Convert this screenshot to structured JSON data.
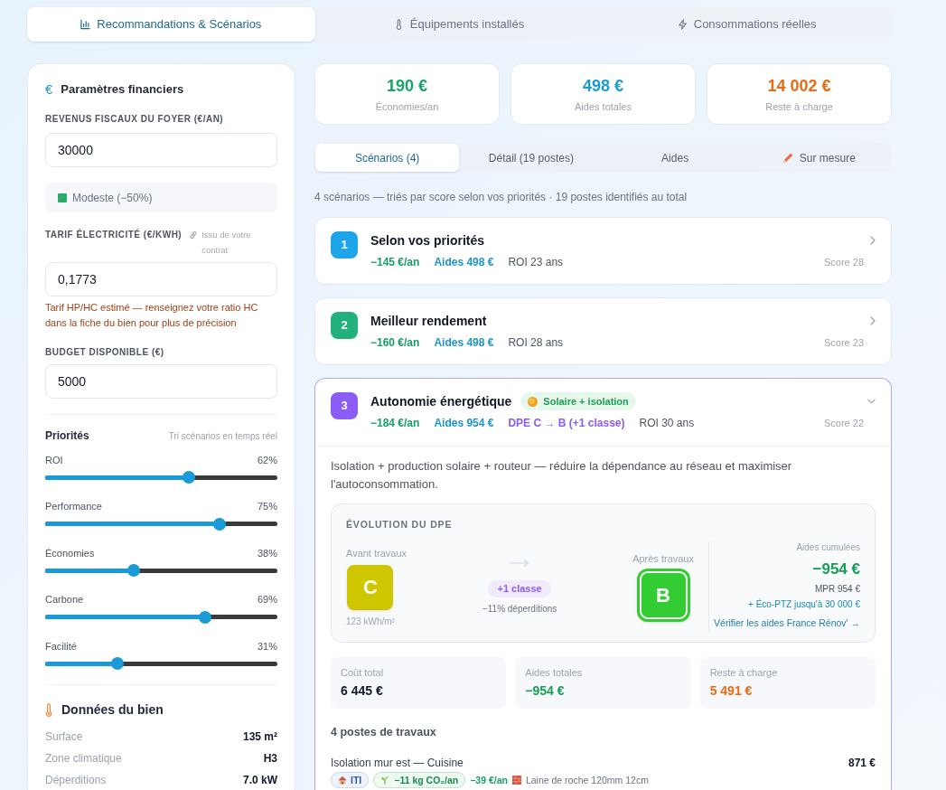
{
  "main_tabs": [
    {
      "label": "Recommandations & Scénarios",
      "selected": true
    },
    {
      "label": "Équipements installés",
      "selected": false
    },
    {
      "label": "Consommations réelles",
      "selected": false
    }
  ],
  "financial_parameters": {
    "icon": "€",
    "title": "Paramètres financiers",
    "income": {
      "label": "REVENUS FISCAUX DU FOYER (€/AN)",
      "value": "30000"
    },
    "income_category": "Modeste (−50%)",
    "tariff": {
      "label": "TARIF ÉLECTRICITÉ (€/KWH)",
      "source": "Issu de votre contrat",
      "value": "0,1773",
      "warning": "Tarif HP/HC estimé — renseignez votre ratio HC dans la fiche du bien pour plus de précision"
    },
    "budget": {
      "label": "BUDGET DISPONIBLE (€)",
      "value": "5000"
    }
  },
  "priorities": {
    "title": "Priorités",
    "hint": "Tri scénarios en temps réel",
    "sliders": [
      {
        "label": "ROI",
        "reading": "62%",
        "level": 0.62
      },
      {
        "label": "Performance",
        "reading": "75%",
        "level": 0.75
      },
      {
        "label": "Économies",
        "reading": "38%",
        "level": 0.38
      },
      {
        "label": "Carbone",
        "reading": "69%",
        "level": 0.69
      },
      {
        "label": "Facilité",
        "reading": "31%",
        "level": 0.31
      }
    ]
  },
  "property_data": {
    "title": "Données du bien",
    "rows": [
      {
        "label": "Surface",
        "value": "135 m²"
      },
      {
        "label": "Zone climatique",
        "value": "H3"
      },
      {
        "label": "Déperditions",
        "value": "7.0 kW"
      }
    ]
  },
  "summary_stats": [
    {
      "kind": "savings",
      "value": "190 €",
      "label": "Économies/an"
    },
    {
      "kind": "aid",
      "value": "498 €",
      "label": "Aides totales"
    },
    {
      "kind": "remaining",
      "value": "14 002 €",
      "label": "Reste à charge"
    }
  ],
  "sub_tabs": [
    {
      "label": "Scénarios (4)",
      "selected": true
    },
    {
      "label": "Détail (19 postes)",
      "selected": false
    },
    {
      "label": "Aides",
      "selected": false
    },
    {
      "label": "Sur mesure",
      "selected": false
    }
  ],
  "scenario_summary": "4 scénarios — triés par score selon vos priorités · 19 postes identifiés au total",
  "scenarios": [
    {
      "rank": "1",
      "color": "#1ea5e9",
      "title": "Selon vos priorités",
      "expanded": false,
      "metrics": [
        {
          "kind": "savings",
          "text": "−145 €/an"
        },
        {
          "kind": "aid",
          "text": "Aides 498 €"
        },
        {
          "kind": "roi",
          "text": "ROI 23 ans"
        }
      ],
      "score": "Score 28"
    },
    {
      "rank": "2",
      "color": "#22b07d",
      "title": "Meilleur rendement",
      "expanded": false,
      "metrics": [
        {
          "kind": "savings",
          "text": "−160 €/an"
        },
        {
          "kind": "aid",
          "text": "Aides 498 €"
        },
        {
          "kind": "roi",
          "text": "ROI 28 ans"
        }
      ],
      "score": "Score 23"
    },
    {
      "rank": "3",
      "color": "#8b5cf6",
      "title": "Autonomie énergétique",
      "tag": "Solaire + isolation",
      "expanded": true,
      "metrics": [
        {
          "kind": "savings",
          "text": "−184 €/an"
        },
        {
          "kind": "aid",
          "text": "Aides 954 €"
        },
        {
          "kind": "dpe",
          "text": "DPE C → B (+1 classe)"
        },
        {
          "kind": "roi",
          "text": "ROI 30 ans"
        }
      ],
      "score": "Score 22",
      "details": {
        "description": "Isolation + production solaire + routeur — réduire la dépendance au réseau et maximiser l'autoconsommation.",
        "dpe": {
          "title": "ÉVOLUTION DU DPE",
          "before": {
            "label": "Avant travaux",
            "class": "C",
            "color": "#cfc600",
            "consumption": "123 kWh/m²"
          },
          "gain": "+1 classe",
          "loss_reduction": "−11% déperditions",
          "after": {
            "label": "Après travaux",
            "class": "B",
            "color": "#33cc33"
          },
          "aid_label": "Aides cumulées",
          "aid_total": "−954 €",
          "mpr": "MPR 954 €",
          "eco_ptz": "+ Éco-PTZ jusqu'à 30 000 €",
          "link": "Vérifier les aides France Rénov' →"
        },
        "totals": [
          {
            "kind": "cost",
            "label": "Coût total",
            "value": "6 445 €"
          },
          {
            "kind": "aid",
            "label": "Aides totales",
            "value": "−954 €"
          },
          {
            "kind": "remaining",
            "label": "Reste à charge",
            "value": "5 491 €"
          }
        ],
        "works_title": "4 postes de travaux",
        "works": [
          {
            "title": "Isolation mur est — Cuisine",
            "price": "871 €",
            "tags": [
              {
                "kind": "technique",
                "text": "ITI"
              },
              {
                "kind": "carbon",
                "text": "−11 kg CO₂/an"
              },
              {
                "kind": "savings",
                "text": "−39 €/an"
              },
              {
                "kind": "material",
                "text": "Laine de roche 120mm 12cm"
              }
            ]
          }
        ]
      }
    }
  ]
}
